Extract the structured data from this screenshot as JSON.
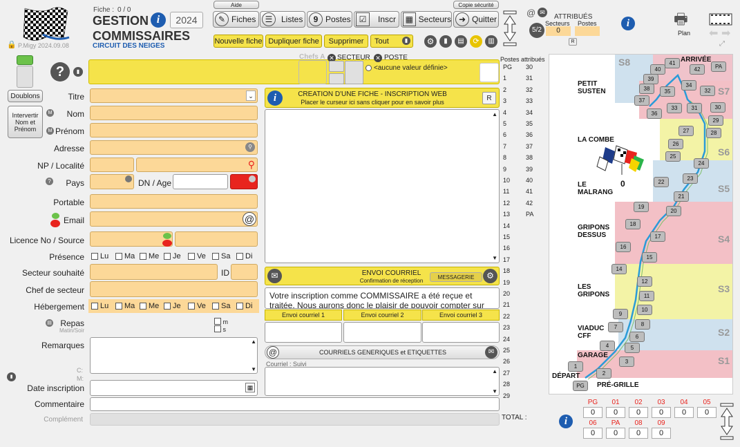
{
  "header": {
    "fiche_label": "Fiche :",
    "fiche_value": "0 / 0",
    "title1": "GESTION",
    "title2": "COMMISSAIRES",
    "subtitle": "CIRCUIT DES NEIGES",
    "year": "2024",
    "user": "P.Migy 2024.09.08",
    "aide": "Aide",
    "copie": "Copie sécurité"
  },
  "toolbar": {
    "fiches": "Fiches",
    "listes": "Listes",
    "postes": "Postes",
    "inscr": "Inscr",
    "secteurs": "Secteurs",
    "quitter": "Quitter"
  },
  "actions": {
    "nouvelle": "Nouvelle fiche",
    "dupliquer": "Dupliquer fiche",
    "supprimer": "Supprimer",
    "tout": "Tout"
  },
  "attributs": {
    "title": "ATTRIBUÉS",
    "secteurs_label": "Secteurs",
    "postes_label": "Postes",
    "secteurs_value": "0",
    "r": "R"
  },
  "plan_label": "Plan",
  "top": {
    "chefs": "Chefs A",
    "secteur": "SECTEUR",
    "poste": "POSTE",
    "poste_value": "<aucune valeur définie>"
  },
  "left": {
    "doublons": "Doublons",
    "intervertir": "Intervertir Nom et Prénom",
    "m": "M"
  },
  "form": {
    "titre": "Titre",
    "nom": "Nom",
    "prenom": "Prénom",
    "adresse": "Adresse",
    "np": "NP / Localité",
    "pays": "Pays",
    "dn": "DN / Age",
    "portable": "Portable",
    "email": "Email",
    "licence": "Licence No / Source",
    "presence": "Présence",
    "secteur_souhaite": "Secteur souhaité",
    "id": "ID",
    "chef": "Chef de secteur",
    "hebergement": "Hébergement",
    "repas": "Repas",
    "repas_sub": "Matin/Soir",
    "repas_m": "m",
    "repas_s": "s",
    "remarques": "Remarques",
    "c": "C:",
    "mm": "M:",
    "date_inscription": "Date inscription",
    "commentaire": "Commentaire",
    "complement": "Complément"
  },
  "days": [
    "Lu",
    "Ma",
    "Me",
    "Je",
    "Ve",
    "Sa",
    "Di"
  ],
  "web": {
    "title": "CREATION D'UNE FICHE - INSCRIPTION WEB",
    "subtitle": "Placer le curseur ici sans cliquer pour en savoir plus",
    "r": "R"
  },
  "mail": {
    "title": "ENVOI COURRIEL",
    "subtitle": "Confirmation de réception",
    "messagerie": "MESSAGERIE",
    "text": "Votre inscription comme COMMISSAIRE a été reçue et traitée. Nous aurons donc le plaisir de pouvoir compter sur",
    "b1": "Envoi courriel 1",
    "b2": "Envoi courriel 2",
    "b3": "Envoi courriel 3"
  },
  "generic": {
    "title": "COURRIELS GENERIQUES et ETIQUETTES",
    "suivi": "Courriel : Suivi"
  },
  "postes_attr": {
    "header": "Postes attribués",
    "pos": [
      "PG",
      "1",
      "2",
      "3",
      "4",
      "5",
      "6",
      "7",
      "8",
      "9",
      "10",
      "11",
      "12",
      "13"
    ],
    "num1": [
      "30",
      "31",
      "32",
      "33",
      "34",
      "35",
      "36",
      "37",
      "38",
      "39",
      "40",
      "41",
      "42",
      "PA"
    ],
    "num2": [
      "14",
      "15",
      "16",
      "17",
      "18",
      "19",
      "20",
      "21",
      "22",
      "23",
      "24",
      "25",
      "26",
      "27",
      "28",
      "29"
    ],
    "total": "TOTAL :"
  },
  "map": {
    "arrivee": "ARRIVÉE",
    "depart": "DÉPART",
    "pregrille": "PRÉ-GRILLE",
    "flag_count": "0",
    "places": [
      "PETIT SUSTEN",
      "LA COMBE",
      "LE MALRANG",
      "GRIPONS DESSUS",
      "LES GRIPONS",
      "VIADUC CFF",
      "GARAGE"
    ],
    "sectors": [
      "S8",
      "S7",
      "S6",
      "S5",
      "S4",
      "S3",
      "S2",
      "S1"
    ]
  },
  "bottom": {
    "labels1": [
      "PG",
      "01",
      "02",
      "03",
      "04",
      "05"
    ],
    "labels2": [
      "06",
      "PA",
      "08",
      "09"
    ],
    "values1": [
      "0",
      "0",
      "0",
      "0",
      "0",
      "0"
    ],
    "values2": [
      "0",
      "0",
      "0",
      "0"
    ]
  },
  "colors": {
    "accent": "#f5e34a",
    "field": "#fcd898",
    "red": "#e8241e",
    "blue": "#1e5db0"
  }
}
